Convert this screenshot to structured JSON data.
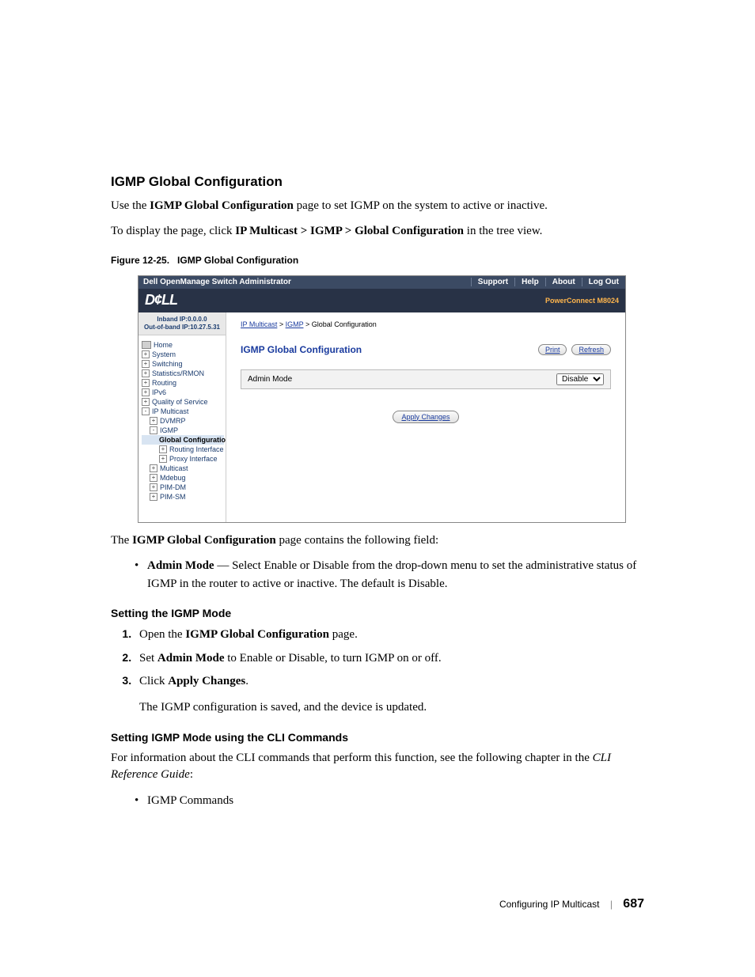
{
  "section": {
    "title": "IGMP Global Configuration",
    "intro1_a": "Use the ",
    "intro1_bold": "IGMP Global Configuration",
    "intro1_b": " page to set IGMP on the system to active or inactive.",
    "intro2_a": "To display the page, click ",
    "intro2_bold": "IP Multicast > IGMP > Global Configuration",
    "intro2_b": " in the tree view."
  },
  "figure": {
    "label": "Figure 12-25.",
    "title": "IGMP Global Configuration"
  },
  "shot": {
    "titlebar": "Dell OpenManage Switch Administrator",
    "links": {
      "support": "Support",
      "help": "Help",
      "about": "About",
      "logout": "Log Out"
    },
    "logo": "D¢LL",
    "model": "PowerConnect M8024",
    "ip1": "Inband IP:0.0.0.0",
    "ip2": "Out-of-band IP:10.27.5.31",
    "tree": {
      "home": "Home",
      "system": "System",
      "switching": "Switching",
      "stats": "Statistics/RMON",
      "routing": "Routing",
      "ipv6": "IPv6",
      "qos": "Quality of Service",
      "ipm": "IP Multicast",
      "dvmrp": "DVMRP",
      "igmp": "IGMP",
      "global": "Global Configuratio",
      "rint": "Routing Interface",
      "pint": "Proxy Interface",
      "mcast": "Multicast",
      "mdebug": "Mdebug",
      "pimdm": "PIM-DM",
      "pimsm": "PIM-SM"
    },
    "crumb": {
      "a": "IP Multicast",
      "b": "IGMP",
      "c": "Global Configuration",
      "sep": " > "
    },
    "panel_title": "IGMP Global Configuration",
    "print": "Print",
    "refresh": "Refresh",
    "field_label": "Admin Mode",
    "field_value": "Disable",
    "apply": "Apply Changes"
  },
  "after_fig": {
    "line1_a": "The ",
    "line1_bold": "IGMP Global Configuration",
    "line1_b": " page contains the following field:",
    "bullet_lead": "Admin Mode",
    "bullet_rest": " — Select Enable or Disable from the drop-down menu to set the administrative status of IGMP in the router to active or inactive. The default is Disable."
  },
  "setmode": {
    "heading": "Setting the IGMP Mode",
    "s1a": "Open the ",
    "s1b": "IGMP Global Configuration",
    "s1c": " page.",
    "s2a": "Set ",
    "s2b": "Admin Mode",
    "s2c": " to Enable or Disable, to turn IGMP on or off.",
    "s3a": "Click ",
    "s3b": "Apply Changes",
    "s3c": ".",
    "s3note": "The IGMP configuration is saved, and the device is updated."
  },
  "cli": {
    "heading": "Setting IGMP Mode using the CLI Commands",
    "body": "For information about the CLI commands that perform this function, see the following chapter in the ",
    "ital": "CLI Reference Guide",
    "colon": ":",
    "bullet": "IGMP Commands"
  },
  "footer": {
    "section": "Configuring IP Multicast",
    "page": "687"
  }
}
